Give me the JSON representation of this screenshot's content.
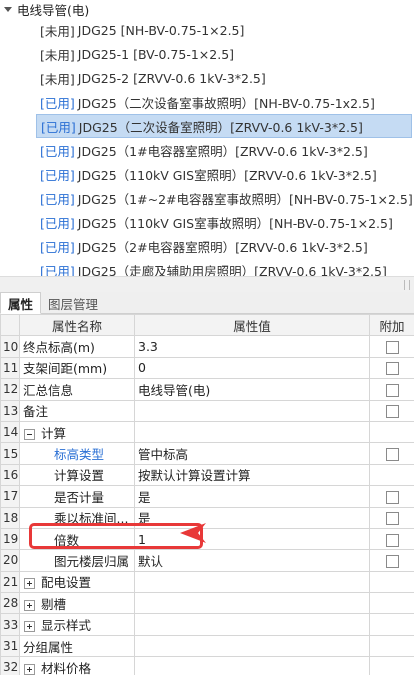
{
  "tree": {
    "header": "电线导管(电)",
    "items": [
      {
        "tag": "[未用]",
        "used": false,
        "text": "JDG25 [NH-BV-0.75-1×2.5]"
      },
      {
        "tag": "[未用]",
        "used": false,
        "text": "JDG25-1 [BV-0.75-1×2.5]"
      },
      {
        "tag": "[未用]",
        "used": false,
        "text": "JDG25-2 [ZRVV-0.6 1kV-3*2.5]"
      },
      {
        "tag": "[已用]",
        "used": true,
        "text": "JDG25（二次设备室事故照明）[NH-BV-0.75-1x2.5]"
      },
      {
        "tag": "[已用]",
        "used": true,
        "text": "JDG25（二次设备室照明）[ZRVV-0.6 1kV-3*2.5]",
        "selected": true
      },
      {
        "tag": "[已用]",
        "used": true,
        "text": "JDG25（1#电容器室照明）[ZRVV-0.6 1kV-3*2.5]"
      },
      {
        "tag": "[已用]",
        "used": true,
        "text": "JDG25（110kV GIS室照明）[ZRVV-0.6 1kV-3*2.5]"
      },
      {
        "tag": "[已用]",
        "used": true,
        "text": "JDG25（1#~2#电容器室事故照明）[NH-BV-0.75-1×2.5]"
      },
      {
        "tag": "[已用]",
        "used": true,
        "text": "JDG25（110kV GIS室事故照明）[NH-BV-0.75-1×2.5]"
      },
      {
        "tag": "[已用]",
        "used": true,
        "text": "JDG25（2#电容器室照明）[ZRVV-0.6 1kV-3*2.5]"
      },
      {
        "tag": "[已用]",
        "used": true,
        "text": "JDG25（走廊及辅助用房照明）[ZRVV-0.6 1kV-3*2.5]"
      }
    ]
  },
  "tabs": [
    "属性",
    "图层管理"
  ],
  "grid": {
    "columns": [
      "属性名称",
      "属性值",
      "附加"
    ],
    "rows": [
      {
        "num": "10",
        "name": "终点标高(m)",
        "value": "3.3",
        "check": true
      },
      {
        "num": "11",
        "name": "支架间距(mm)",
        "value": "0",
        "check": true
      },
      {
        "num": "12",
        "name": "汇总信息",
        "value": "电线导管(电)",
        "check": true
      },
      {
        "num": "13",
        "name": "备注",
        "value": "",
        "check": true
      },
      {
        "num": "14",
        "name": "计算",
        "value": "",
        "check": false,
        "group": "minus"
      },
      {
        "num": "15",
        "name": "标高类型",
        "value": "管中标高",
        "check": true,
        "indent": true,
        "highlight": true
      },
      {
        "num": "16",
        "name": "计算设置",
        "value": "按默认计算设置计算",
        "check": false,
        "indent": true
      },
      {
        "num": "17",
        "name": "是否计量",
        "value": "是",
        "check": true,
        "indent": true
      },
      {
        "num": "18",
        "name": "乘以标准间...",
        "value": "是",
        "check": true,
        "indent": true
      },
      {
        "num": "19",
        "name": "倍数",
        "value": "1",
        "check": true,
        "indent": true
      },
      {
        "num": "20",
        "name": "图元楼层归属",
        "value": "默认",
        "check": true,
        "indent": true
      },
      {
        "num": "21",
        "name": "配电设置",
        "value": "",
        "check": false,
        "group": "plus"
      },
      {
        "num": "28",
        "name": "剔槽",
        "value": "",
        "check": false,
        "group": "plus"
      },
      {
        "num": "33",
        "name": "显示样式",
        "value": "",
        "check": false,
        "group": "plus"
      },
      {
        "num": "31",
        "name": "分组属性",
        "value": "",
        "check": false,
        "group": "none"
      },
      {
        "num": "32",
        "name": "材料价格",
        "value": "",
        "check": false,
        "group": "plus"
      }
    ]
  },
  "colors": {
    "used_tag": "#2a6fd4",
    "selected_bg": "#c5dbf3",
    "annotation": "#e83838"
  }
}
